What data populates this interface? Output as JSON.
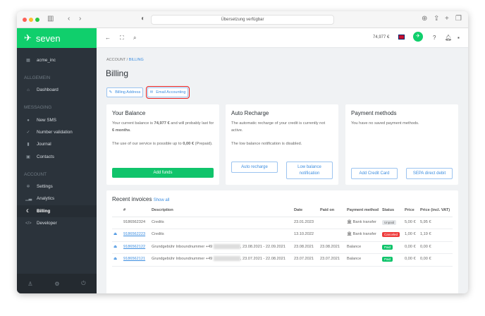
{
  "browser": {
    "url_text": "Übersetzung verfügbar"
  },
  "brand": {
    "name": "seven",
    "color": "#10cf6c"
  },
  "topbar": {
    "balance": "74,977 €"
  },
  "sidebar": {
    "account_name": "acme_inc",
    "sections": [
      {
        "title": "ALLGEMEIN",
        "items": [
          {
            "label": "Dashboard",
            "icon": "dashboard-icon"
          }
        ]
      },
      {
        "title": "MESSAGING",
        "items": [
          {
            "label": "New SMS",
            "icon": "chat-icon"
          },
          {
            "label": "Number validation",
            "icon": "check-icon"
          },
          {
            "label": "Journal",
            "icon": "book-icon"
          },
          {
            "label": "Contacts",
            "icon": "contacts-icon"
          }
        ]
      },
      {
        "title": "ACCOUNT",
        "items": [
          {
            "label": "Settings",
            "icon": "gear-icon"
          },
          {
            "label": "Analytics",
            "icon": "chart-icon"
          },
          {
            "label": "Billing",
            "icon": "moon-icon",
            "active": true
          },
          {
            "label": "Developer",
            "icon": "code-icon"
          }
        ]
      }
    ]
  },
  "breadcrumb": {
    "parent": "ACCOUNT",
    "sep": "/",
    "current": "BILLING"
  },
  "page": {
    "title": "Billing",
    "billing_address": "Billing Address",
    "email_accounting": "Email Accounting"
  },
  "balance": {
    "title": "Your Balance",
    "line1a": "Your current balance is ",
    "amount": "74,977 €",
    "line1b": " and will probably last for ",
    "duration": "6 months",
    "line1c": ".",
    "line2a": "The use of our service is possible up to ",
    "limit": "0,00 €",
    "line2b": " (Prepaid).",
    "button": "Add funds"
  },
  "recharge": {
    "title": "Auto Recharge",
    "text1": "The automatic recharge of your credit is currently not active.",
    "text2": "The low balance notification is disabled.",
    "btn1": "Auto recharge",
    "btn2": "Low balance notification"
  },
  "payment": {
    "title": "Payment methods",
    "text": "You have no saved payment methods.",
    "btn1": "Add Credit Card",
    "btn2": "SEPA direct debit"
  },
  "invoices": {
    "title": "Recent invoices",
    "show_all": "Show all",
    "columns": [
      "#",
      "Description",
      "Date",
      "Paid on",
      "Payment method",
      "Status",
      "Price",
      "Price (incl. VAT)"
    ],
    "rows": [
      {
        "id": "9186562324",
        "desc": "Credits",
        "desc2": "",
        "date": "23.01.2023",
        "paid": "",
        "method": "🏛 Bank transfer",
        "status": "Unpaid",
        "status_color": "#e4e7ea",
        "price": "5,00 €",
        "vat": "5,95 €",
        "link": false
      },
      {
        "id": "9186562223",
        "desc": "Credits",
        "desc2": "",
        "date": "13.10.2022",
        "paid": "",
        "method": "🏛 Bank transfer",
        "status": "Canceled",
        "status_color": "#ef3b3b",
        "price": "1,00 €",
        "vat": "1,19 €",
        "link": true
      },
      {
        "id": "9186562122",
        "desc": "Grundgebühr Inboundnummer +49",
        "desc2": ", 23.08.2021 - 22.09.2021",
        "date": "23.08.2021",
        "paid": "23.08.2021",
        "method": "Balance",
        "status": "Paid",
        "status_color": "#10c46b",
        "price": "0,00 €",
        "vat": "0,00 €",
        "link": true
      },
      {
        "id": "9186562121",
        "desc": "Grundgebühr Inboundnummer +49",
        "desc2": ", 23.07.2021 - 22.08.2021",
        "date": "23.07.2021",
        "paid": "23.07.2021",
        "method": "Balance",
        "status": "Paid",
        "status_color": "#10c46b",
        "price": "0,00 €",
        "vat": "0,00 €",
        "link": true
      }
    ]
  }
}
